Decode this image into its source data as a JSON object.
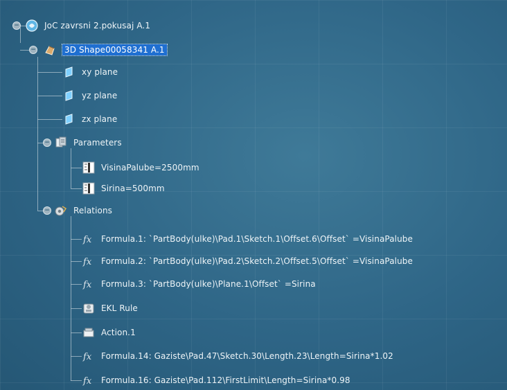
{
  "tree": {
    "root": {
      "label": "JoC zavrsni 2.pokusaj A.1",
      "icon": "product-icon"
    },
    "shape": {
      "label": "3D Shape00058341 A.1",
      "icon": "part-icon",
      "selected": true
    },
    "planes": [
      {
        "label": "xy plane",
        "icon": "plane-icon"
      },
      {
        "label": "yz plane",
        "icon": "plane-icon"
      },
      {
        "label": "zx plane",
        "icon": "plane-icon"
      }
    ],
    "parameters": {
      "label": "Parameters",
      "icon": "parameters-icon",
      "items": [
        {
          "label": "VisinaPalube=2500mm",
          "icon": "length-parameter-icon"
        },
        {
          "label": "Sirina=500mm",
          "icon": "length-parameter-icon"
        }
      ]
    },
    "relations": {
      "label": "Relations",
      "icon": "relations-icon",
      "items": [
        {
          "label": "Formula.1: `PartBody(ulke)\\Pad.1\\Sketch.1\\Offset.6\\Offset` =VisinaPalube",
          "icon": "formula-icon"
        },
        {
          "label": "Formula.2: `PartBody(ulke)\\Pad.2\\Sketch.2\\Offset.5\\Offset` =VisinaPalube",
          "icon": "formula-icon"
        },
        {
          "label": "Formula.3: `PartBody(ulke)\\Plane.1\\Offset` =Sirina",
          "icon": "formula-icon"
        },
        {
          "label": "EKL Rule",
          "icon": "ekl-rule-icon"
        },
        {
          "label": "Action.1",
          "icon": "action-icon"
        },
        {
          "label": "Formula.14: Gaziste\\Pad.47\\Sketch.30\\Length.23\\Length=Sirina*1.02",
          "icon": "formula-icon"
        },
        {
          "label": "Formula.16: Gaziste\\Pad.112\\FirstLimit\\Length=Sirina*0.98",
          "icon": "formula-icon"
        }
      ]
    }
  },
  "colors": {
    "background": "#2e6586",
    "selection": "#1f6fd1",
    "tree_lines": "#b9cad4"
  }
}
